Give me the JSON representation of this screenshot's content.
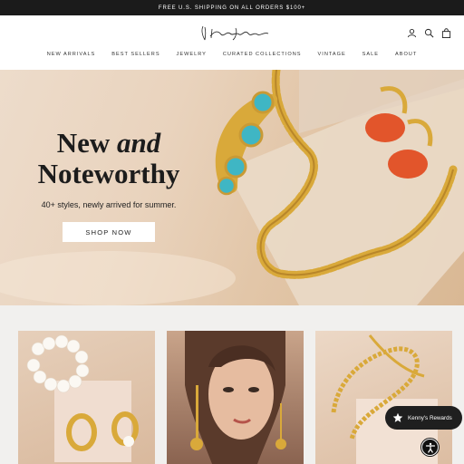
{
  "announcement": "FREE U.S. SHIPPING ON ALL ORDERS $100+",
  "brand": {
    "logo_alt": "Kenneth Jay Lane"
  },
  "header_icons": [
    "account-icon",
    "search-icon",
    "bag-icon"
  ],
  "nav": {
    "items": [
      "NEW ARRIVALS",
      "BEST SELLERS",
      "JEWELRY",
      "CURATED COLLECTIONS",
      "VINTAGE",
      "SALE",
      "ABOUT"
    ]
  },
  "hero": {
    "title_line1_a": "New ",
    "title_line1_b": "and",
    "title_line2": "Noteworthy",
    "subtitle": "40+ styles, newly arrived for summer.",
    "button": "SHOP NOW"
  },
  "rewards": {
    "label": "Kenny's Rewards",
    "icon": "star-icon"
  },
  "accessibility": {
    "icon": "accessibility-icon"
  },
  "colors": {
    "announce_bg": "#1b1b1b",
    "turquoise": "#3fb6c4",
    "coral": "#e2552b",
    "gold": "#d9a93a"
  }
}
